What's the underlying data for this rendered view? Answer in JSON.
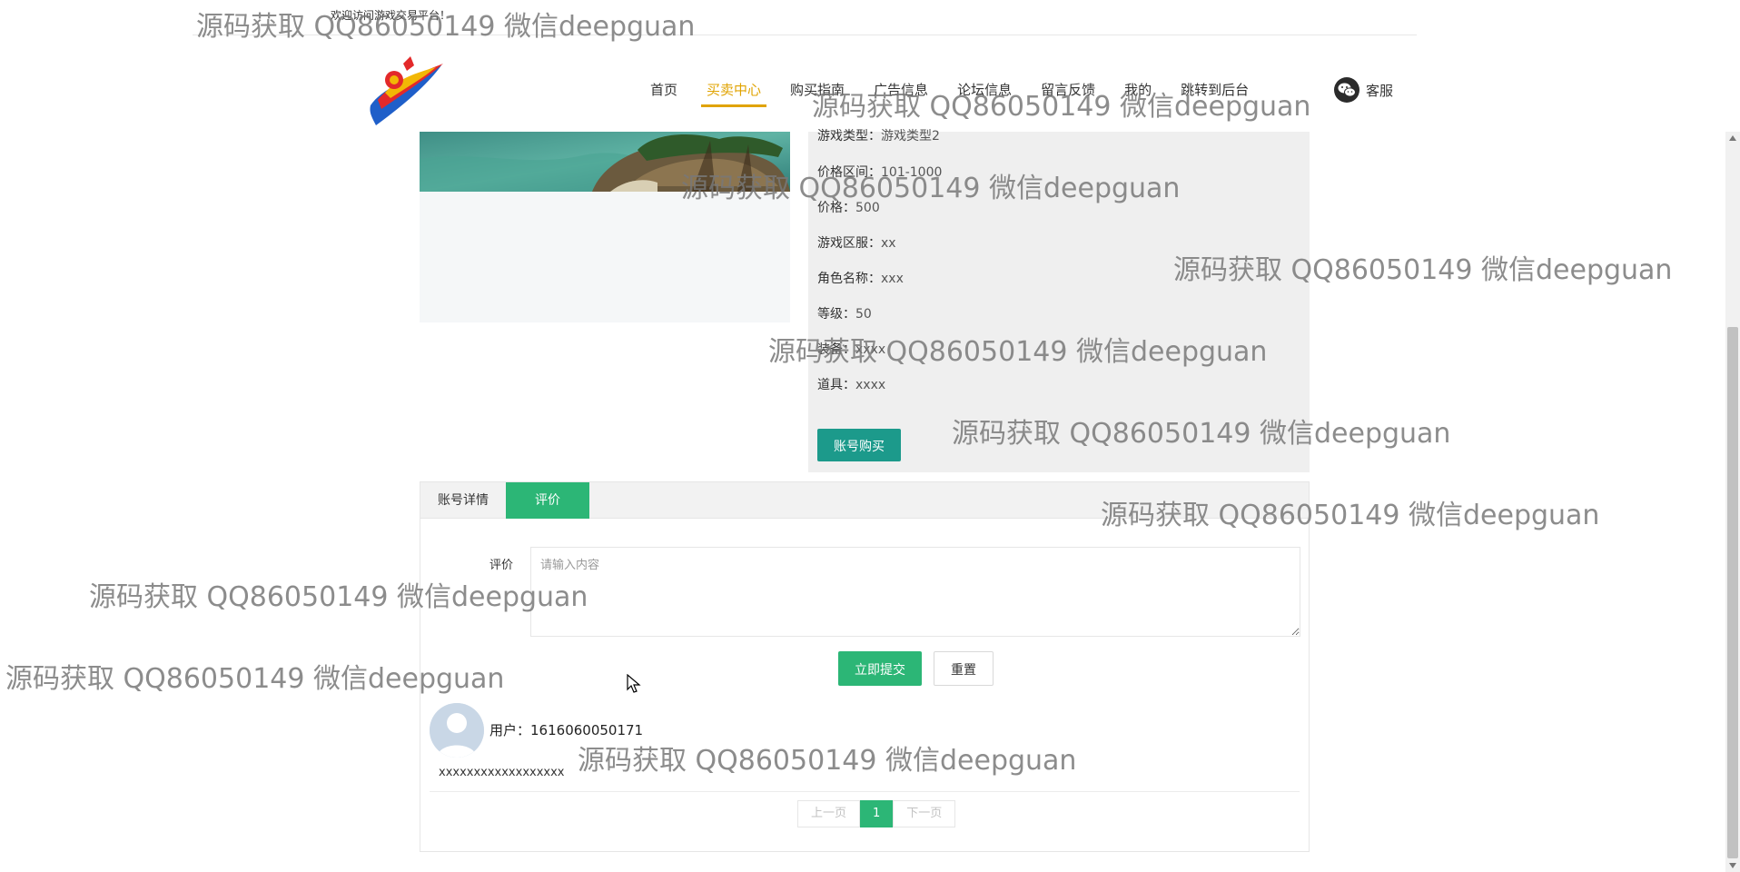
{
  "top": {
    "welcome": "欢迎访问游戏交易平台！"
  },
  "nav": {
    "items": [
      "首页",
      "买卖中心",
      "购买指南",
      "广告信息",
      "论坛信息",
      "留言反馈",
      "我的",
      "跳转到后台"
    ],
    "active_index": 1,
    "service_label": "客服"
  },
  "info": {
    "rows": [
      {
        "label": "游戏类型：",
        "value": "游戏类型2"
      },
      {
        "label": "价格区间：",
        "value": "101-1000"
      },
      {
        "label": "价格：",
        "value": "500"
      },
      {
        "label": "游戏区服：",
        "value": "xx"
      },
      {
        "label": "角色名称：",
        "value": "xxx"
      },
      {
        "label": "等级：",
        "value": "50"
      },
      {
        "label": "装备：",
        "value": "xxxx"
      },
      {
        "label": "道具：",
        "value": "xxxx"
      }
    ],
    "buy_button": "账号购买"
  },
  "tabs": {
    "items": [
      "账号详情",
      "评价"
    ],
    "active_index": 1
  },
  "review": {
    "label": "评价",
    "placeholder": "请输入内容",
    "submit": "立即提交",
    "reset": "重置"
  },
  "comment": {
    "user_label": "用户：",
    "user_id": "1616060050171",
    "content": "xxxxxxxxxxxxxxxxxx"
  },
  "pagination": {
    "prev": "上一页",
    "current": "1",
    "next": "下一页"
  },
  "watermark": {
    "text": "源码获取 QQ86050149 微信deepguan"
  },
  "colors": {
    "accent_green": "#2cb676",
    "buy_button": "#1c9a8b",
    "nav_active": "#e0a300"
  }
}
